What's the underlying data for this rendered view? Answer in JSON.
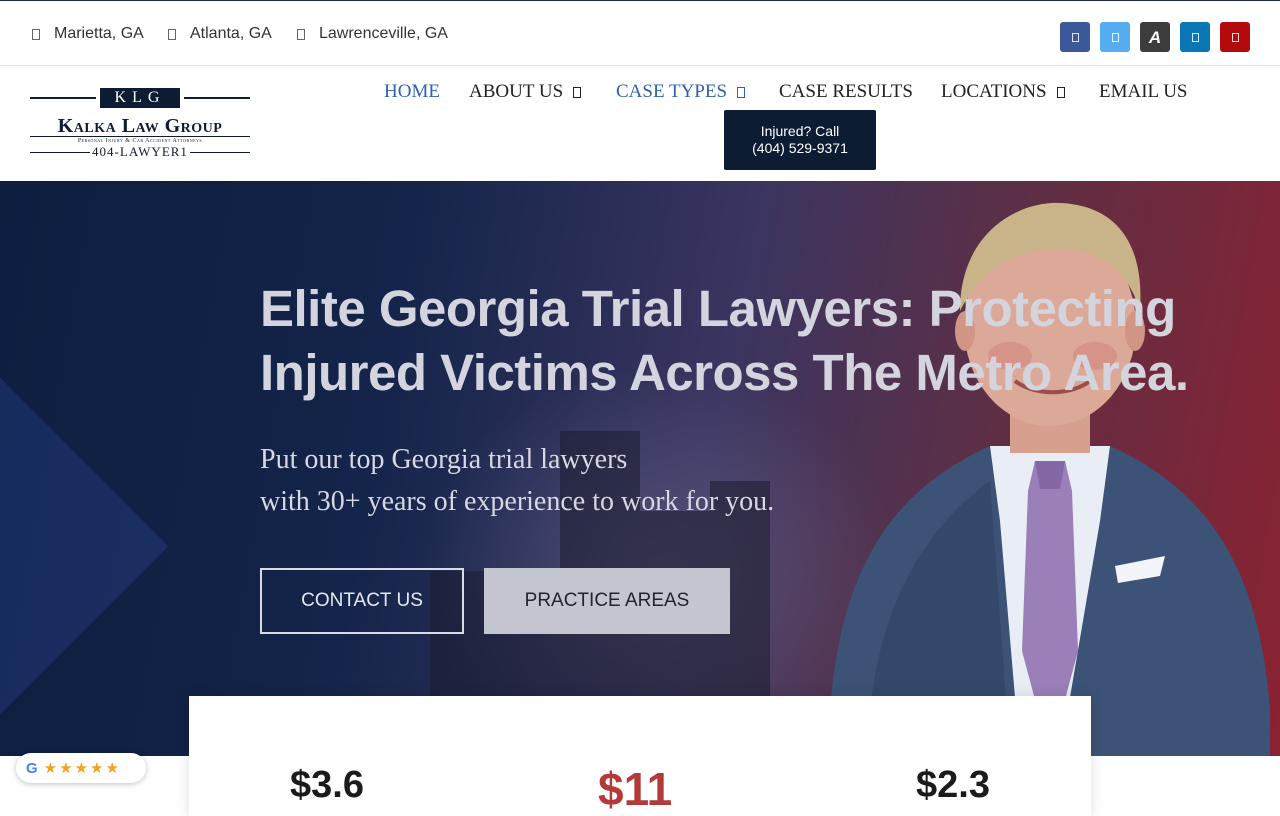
{
  "topbar": {
    "locations": [
      "Marietta, GA",
      "Atlanta, GA",
      "Lawrenceville, GA"
    ],
    "socials": [
      {
        "icon": "facebook-icon",
        "color": "#3b5998"
      },
      {
        "icon": "twitter-icon",
        "color": "#55acee"
      },
      {
        "icon": "avvo-icon",
        "color": "#3c3c3c"
      },
      {
        "icon": "linkedin-icon",
        "color": "#0a77b5"
      },
      {
        "icon": "youtube-icon",
        "color": "#b30b0b"
      }
    ]
  },
  "logo": {
    "mark": "KLG",
    "name": "Kalka Law Group",
    "tagline": "Personal Injury & Car Accident Attorneys",
    "phone": "404-LAWYER1"
  },
  "nav": {
    "items": [
      "HOME",
      "ABOUT US",
      "CASE TYPES",
      "CASE RESULTS",
      "LOCATIONS",
      "EMAIL US"
    ],
    "active_color": "#2d62ad"
  },
  "cta": {
    "line1": "Injured? Call",
    "line2": "(404) 529-9371"
  },
  "hero": {
    "headline_line1": "Elite Georgia Trial Lawyers: Protecting",
    "headline_line2": "Injured Victims Across The Metro Area.",
    "sub_line1": "Put our top Georgia trial lawyers",
    "sub_line2": "with 30+ years of experience to work for you.",
    "contact_label": "CONTACT US",
    "practice_label": "PRACTICE AREAS"
  },
  "stats": [
    "$3.6",
    "$11",
    "$2.3"
  ],
  "reviews": {
    "google_letter": "G",
    "stars": 5
  }
}
